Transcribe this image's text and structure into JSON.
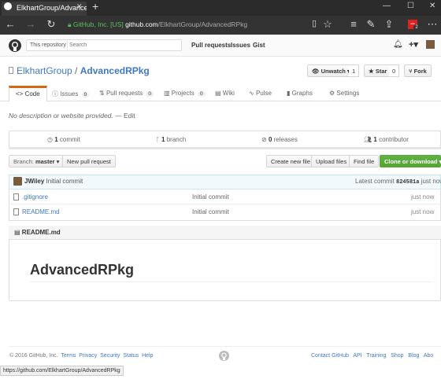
{
  "browser": {
    "tab_title": "ElkhartGroup/Advancec",
    "address": {
      "org_label": "GitHub, Inc. [US]",
      "host": "github.com",
      "path": "/ElkhartGroup/AdvancedRPkg"
    },
    "extension_count": "2",
    "status_url": "https://github.com/ElkhartGroup/AdvancedRPkg"
  },
  "header": {
    "search_scope": "This repository",
    "search_placeholder": "Search",
    "links": [
      "Pull requests",
      "Issues",
      "Gist"
    ]
  },
  "repo": {
    "owner": "ElkhartGroup",
    "separator": "/",
    "name": "AdvancedRPkg",
    "watch_label": "Unwatch",
    "watch_count": "1",
    "star_label": "Star",
    "star_count": "0",
    "fork_label": "Fork"
  },
  "tabs": [
    {
      "label": "Code"
    },
    {
      "label": "Issues",
      "count": "0"
    },
    {
      "label": "Pull requests",
      "count": "0"
    },
    {
      "label": "Projects",
      "count": "0"
    },
    {
      "label": "Wiki"
    },
    {
      "label": "Pulse"
    },
    {
      "label": "Graphs"
    },
    {
      "label": "Settings"
    }
  ],
  "description": {
    "text": "No description or website provided.",
    "dash": "—",
    "edit_label": "Edit"
  },
  "summary": {
    "commits_num": "1",
    "commits_label": "commit",
    "branches_num": "1",
    "branches_label": "branch",
    "releases_num": "0",
    "releases_label": "releases",
    "contributors_num": "1",
    "contributors_label": "contributor"
  },
  "toolbar": {
    "branch_prefix": "Branch:",
    "branch_name": "master",
    "new_pr": "New pull request",
    "create_file": "Create new file",
    "upload_files": "Upload files",
    "find_file": "Find file",
    "clone": "Clone or download"
  },
  "latest_commit": {
    "author": "JWiley",
    "message": "Initial commit",
    "label": "Latest commit",
    "sha": "824581a",
    "age": "just now"
  },
  "files": [
    {
      "name": ".gitignore",
      "message": "Initial commit",
      "age": "just now"
    },
    {
      "name": "README.md",
      "message": "Initial commit",
      "age": "just now"
    }
  ],
  "readme": {
    "header": "README.md",
    "title": "AdvancedRPkg"
  },
  "footer": {
    "copyright": "© 2016 GitHub, Inc.",
    "left_links": [
      "Terms",
      "Privacy",
      "Security",
      "Status",
      "Help"
    ],
    "right_links": [
      "Contact GitHub",
      "API",
      "Training",
      "Shop",
      "Blog",
      "Abo"
    ]
  },
  "colors": {
    "accent": "#4078c0",
    "tab_selected": "#d26911",
    "clone_button": "#55a532"
  }
}
